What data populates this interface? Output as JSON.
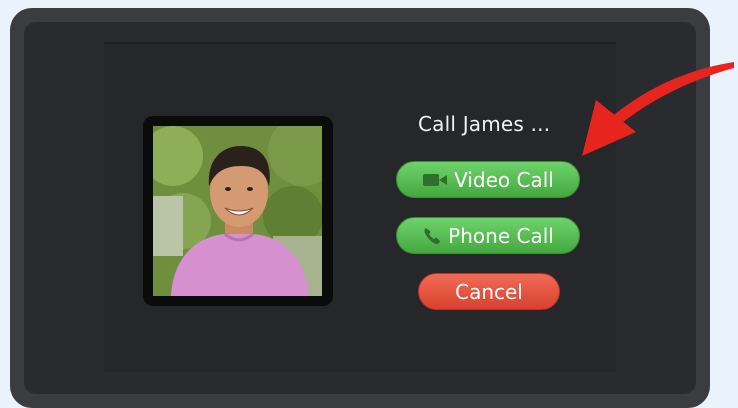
{
  "dialog": {
    "title": "Call James  ...",
    "video_call_label": "Video Call",
    "phone_call_label": "Phone Call",
    "cancel_label": "Cancel"
  },
  "contact": {
    "photo": "contact-photo"
  },
  "colors": {
    "page_background": "#eaf2fb",
    "device_bezel": "#3b3c3e",
    "screen": "#2a2b2e",
    "call_button_green": "#55b950",
    "cancel_button_red": "#e4533e",
    "annotation_arrow": "#e8241f"
  },
  "icons": {
    "video": "video-camera-icon",
    "phone": "phone-handset-icon",
    "annotation": "red-arrow-icon"
  }
}
